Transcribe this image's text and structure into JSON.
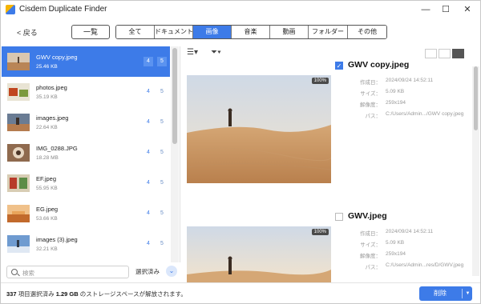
{
  "window": {
    "title": "Cisdem Duplicate Finder",
    "controls": {
      "minimize": "—",
      "maximize": "☐",
      "close": "✕"
    }
  },
  "toolbar": {
    "back_label": "< 戻る",
    "list_label": "一覧",
    "tabs": [
      "全て",
      "ドキュメント",
      "画像",
      "音楽",
      "動画",
      "フォルダー",
      "その他"
    ],
    "active_tab": "画像"
  },
  "files": [
    {
      "name": "GWV copy.jpeg",
      "size": "25.46 KB",
      "count_a": "4",
      "count_b": "5",
      "selected": true
    },
    {
      "name": "photos.jpeg",
      "size": "35.19 KB",
      "count_a": "4",
      "count_b": "5"
    },
    {
      "name": "images.jpeg",
      "size": "22.64 KB",
      "count_a": "4",
      "count_b": "5"
    },
    {
      "name": "IMG_0288.JPG",
      "size": "18.28 MB",
      "count_a": "4",
      "count_b": "5"
    },
    {
      "name": "EF.jpeg",
      "size": "55.95 KB",
      "count_a": "4",
      "count_b": "5"
    },
    {
      "name": "EG.jpeg",
      "size": "53.66 KB",
      "count_a": "4",
      "count_b": "5"
    },
    {
      "name": "images (3).jpeg",
      "size": "32.21 KB",
      "count_a": "4",
      "count_b": "5"
    }
  ],
  "search": {
    "placeholder": "検索",
    "selection_label": "選択済み"
  },
  "preview": {
    "view_icons": [
      "grid-view-icon",
      "compare-view-icon",
      "list-view-icon"
    ],
    "items": [
      {
        "title": "GWV copy.jpeg",
        "checked": true,
        "badge": "100%",
        "meta": [
          {
            "label": "作成日：",
            "value": "2024/09/24 14:52:11"
          },
          {
            "label": "サイズ：",
            "value": "5.09 KB"
          },
          {
            "label": "解像度：",
            "value": "259x194"
          },
          {
            "label": "パス：",
            "value": "C:/Users/Admin.../GWV copy.jpeg"
          }
        ]
      },
      {
        "title": "GWV.jpeg",
        "checked": false,
        "badge": "100%",
        "meta": [
          {
            "label": "作成日：",
            "value": "2024/09/24 14:52:11"
          },
          {
            "label": "サイズ：",
            "value": "5.09 KB"
          },
          {
            "label": "解像度：",
            "value": "259x194"
          },
          {
            "label": "パス：",
            "value": "C:/Users/Admin...res/D/GWV.jpeg"
          }
        ]
      }
    ]
  },
  "status": {
    "count": "337",
    "count_suffix": " 項目選択済み ",
    "size": "1.29 GB",
    "size_suffix": " のストレージスペースが解放されます。"
  },
  "delete": {
    "label": "削除",
    "caret": "▼"
  },
  "colors": {
    "accent": "#3d7be8",
    "background": "#ffffff"
  }
}
